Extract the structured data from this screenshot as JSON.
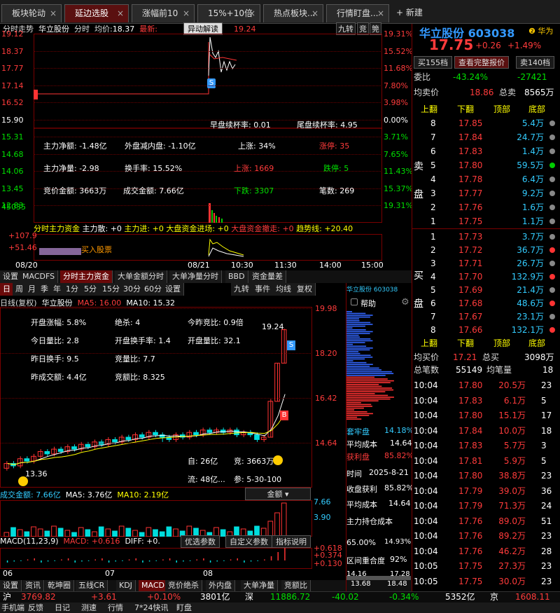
{
  "tabs": [
    {
      "label": "板块轮动"
    },
    {
      "label": "延边选股",
      "active": true
    },
    {
      "label": "涨幅前10"
    },
    {
      "label": "15%+10倍"
    },
    {
      "label": "热点板块..."
    },
    {
      "label": "行情盯盘..."
    }
  ],
  "new_tab_label": "新建",
  "intraday": {
    "header_prefix": "分时走势",
    "stock": "华立股份",
    "mode": "分时",
    "avg_label": "均价:",
    "avg_value": "18.37",
    "latest_label": "最新:",
    "latest_value": "19.24",
    "popup_btn": "异动解读",
    "right_btn1": "九转",
    "right_btn2": "竞",
    "right_btn3": "筦",
    "price_ticks": [
      "19.12",
      "18.37",
      "17.77",
      "17.14",
      "16.52",
      "15.90",
      "15.31",
      "14.68",
      "14.06",
      "13.45",
      "12.83"
    ],
    "pct_ticks": [
      "19.31%",
      "15.52%",
      "11.68%",
      "7.80%",
      "3.98%",
      "0.00%",
      "3.71%",
      "7.65%",
      "11.43%",
      "15.37%",
      "19.31%"
    ],
    "volume_top": "45035",
    "overlay": [
      [
        "早盘续杯率: 0.01",
        "尾盘续杯率: 4.95"
      ],
      [
        "主力净额: -1.48亿",
        "外盘减内盘: -1.10亿",
        "上涨: 34%",
        "涨停: 35"
      ],
      [
        "主力净量: -2.98",
        "换手率: 15.52%",
        "上涨: 1669",
        "跌停: 5"
      ],
      [
        "竞价金额: 3663万",
        "成交金额: 7.66亿",
        "下跌: 3307",
        "笔数: 269"
      ]
    ],
    "main_force_line": {
      "title": "分时主力资金",
      "a": "主力散: +0",
      "b": "主力进: +0",
      "c": "大盘资金进场: +0",
      "d": "大盘资金撤走: +0",
      "e": "趋势线: +20.40"
    },
    "mf_ticks": [
      "+107.9",
      "+51.46"
    ],
    "buy_label": "买入股票",
    "time_ticks": [
      "08/20",
      "08/21",
      "10:30",
      "11:30",
      "14:00",
      "15:00"
    ],
    "sub_tabs": [
      "设置",
      "MACDFS",
      "分时主力资金",
      "大单金额分时",
      "大单净量分时",
      "BBD",
      "资金量差"
    ]
  },
  "kline": {
    "periods": [
      "日",
      "周",
      "月",
      "季",
      "年",
      "1分",
      "5分",
      "15分",
      "30分",
      "60分",
      "设置"
    ],
    "right_btns": [
      "九转",
      "事件",
      "均线",
      "复权"
    ],
    "header_label": "日线(复权)",
    "stock": "华立股份",
    "ma5": "MA5: 16.00",
    "ma10": "MA10: 15.32",
    "price_ticks": [
      "19.98",
      "18.20",
      "16.42",
      "14.64"
    ],
    "info": [
      [
        "开盘涨幅: 5.8%",
        "绝杀: 4",
        "今昨竞比: 0.9倍"
      ],
      [
        "今日量比: 2.8",
        "开盘换手率: 1.4",
        "开盘量比: 32.1"
      ],
      [
        "昨日换手: 9.5",
        "竞量比: 7.7"
      ],
      [
        "昨成交额: 4.4亿",
        "竞额比: 8.325"
      ]
    ],
    "high_mark": "19.24",
    "low_mark": "13.36",
    "free_cap": "自: 26亿",
    "bid_amt": "竞: 3663万",
    "float_cap": "流: 48亿...",
    "params": "参: 5-30-100",
    "amount_label": "成交金额: 7.66亿",
    "amount_ma5": "MA5: 3.76亿",
    "amount_ma10": "MA10: 2.19亿",
    "amount_select": "金额",
    "amount_ticks": [
      "7.66",
      "3.90"
    ],
    "macd_label": "MACD(11,23,9)",
    "macd_val": "MACD: +0.616",
    "diff_val": "DIFF: +0.",
    "macd_btns": [
      "优选参数",
      "自定义参数",
      "指标说明"
    ],
    "macd_ticks": [
      "+0.618",
      "+0.374",
      "+0.130"
    ],
    "months": [
      "06",
      "07",
      "08"
    ],
    "sub_tabs": [
      "设置",
      "资讯",
      "乾坤圈",
      "五线CR",
      "KDJ",
      "MACD",
      "竞价绝杀",
      "外内盘",
      "大单净量",
      "竞额比"
    ],
    "candles": [
      {
        "o": 13.4,
        "c": 13.6,
        "h": 13.7,
        "l": 13.3
      },
      {
        "o": 13.6,
        "c": 13.5,
        "h": 13.7,
        "l": 13.4
      },
      {
        "o": 13.5,
        "c": 13.8,
        "h": 13.9,
        "l": 13.4
      },
      {
        "o": 13.8,
        "c": 13.7,
        "h": 13.9,
        "l": 13.6
      },
      {
        "o": 13.7,
        "c": 13.9,
        "h": 14.0,
        "l": 13.6
      },
      {
        "o": 13.9,
        "c": 14.1,
        "h": 14.2,
        "l": 13.8
      },
      {
        "o": 14.1,
        "c": 14.0,
        "h": 14.2,
        "l": 13.9
      },
      {
        "o": 14.0,
        "c": 14.2,
        "h": 14.3,
        "l": 13.9
      },
      {
        "o": 14.2,
        "c": 14.1,
        "h": 14.3,
        "l": 14.0
      },
      {
        "o": 14.1,
        "c": 14.3,
        "h": 14.4,
        "l": 14.0
      },
      {
        "o": 14.3,
        "c": 14.2,
        "h": 14.4,
        "l": 14.1
      },
      {
        "o": 14.2,
        "c": 14.4,
        "h": 14.5,
        "l": 14.1
      },
      {
        "o": 14.4,
        "c": 14.3,
        "h": 14.5,
        "l": 14.2
      },
      {
        "o": 14.3,
        "c": 14.5,
        "h": 14.6,
        "l": 14.2
      },
      {
        "o": 14.5,
        "c": 14.4,
        "h": 14.6,
        "l": 14.3
      },
      {
        "o": 14.4,
        "c": 14.6,
        "h": 14.7,
        "l": 14.3
      },
      {
        "o": 14.6,
        "c": 14.5,
        "h": 14.7,
        "l": 14.4
      },
      {
        "o": 14.5,
        "c": 14.7,
        "h": 14.8,
        "l": 14.4
      },
      {
        "o": 14.7,
        "c": 14.6,
        "h": 14.8,
        "l": 14.5
      },
      {
        "o": 14.6,
        "c": 14.8,
        "h": 14.9,
        "l": 14.5
      },
      {
        "o": 14.8,
        "c": 14.7,
        "h": 14.9,
        "l": 14.6
      },
      {
        "o": 14.7,
        "c": 14.9,
        "h": 15.0,
        "l": 14.6
      },
      {
        "o": 14.9,
        "c": 14.8,
        "h": 15.0,
        "l": 14.7
      },
      {
        "o": 14.8,
        "c": 14.7,
        "h": 14.9,
        "l": 14.5
      },
      {
        "o": 14.7,
        "c": 14.6,
        "h": 14.8,
        "l": 14.5
      },
      {
        "o": 14.6,
        "c": 14.8,
        "h": 14.9,
        "l": 14.5
      },
      {
        "o": 14.8,
        "c": 14.7,
        "h": 14.9,
        "l": 14.6
      },
      {
        "o": 14.7,
        "c": 14.9,
        "h": 15.0,
        "l": 14.6
      },
      {
        "o": 14.9,
        "c": 14.8,
        "h": 15.0,
        "l": 14.7
      },
      {
        "o": 14.8,
        "c": 15.0,
        "h": 15.1,
        "l": 14.7
      },
      {
        "o": 15.0,
        "c": 14.9,
        "h": 15.1,
        "l": 14.8
      },
      {
        "o": 14.9,
        "c": 15.0,
        "h": 15.1,
        "l": 14.8
      },
      {
        "o": 15.0,
        "c": 14.9,
        "h": 15.1,
        "l": 14.8
      },
      {
        "o": 14.9,
        "c": 15.0,
        "h": 15.1,
        "l": 14.8
      },
      {
        "o": 15.0,
        "c": 14.8,
        "h": 15.1,
        "l": 14.7
      },
      {
        "o": 14.8,
        "c": 14.9,
        "h": 15.0,
        "l": 14.7
      },
      {
        "o": 14.9,
        "c": 14.8,
        "h": 15.0,
        "l": 14.7
      },
      {
        "o": 14.8,
        "c": 14.6,
        "h": 14.9,
        "l": 14.5
      },
      {
        "o": 14.6,
        "c": 14.7,
        "h": 14.8,
        "l": 14.5
      },
      {
        "o": 14.7,
        "c": 16.2,
        "h": 16.3,
        "l": 14.7
      },
      {
        "o": 16.2,
        "c": 17.8,
        "h": 17.8,
        "l": 16.2
      },
      {
        "o": 17.8,
        "c": 19.2,
        "h": 19.24,
        "l": 17.8
      }
    ]
  },
  "quote": {
    "name": "华立股份",
    "code": "603038",
    "badge": "华为",
    "price": "17.75",
    "change": "+0.26",
    "pct": "+1.49%",
    "btn_buy": "买155档",
    "btn_report": "查看完整报价",
    "btn_sell": "卖140档",
    "weibi_label": "委比",
    "weibi": "-43.24%",
    "weicha": "-27421",
    "avg_label": "均卖价",
    "avg": "18.86",
    "total_label": "总卖",
    "total": "8565万",
    "col_up": "上翻",
    "col_down": "下翻",
    "col_top": "顶部",
    "col_bottom": "底部",
    "sell_side": "卖盘",
    "buy_side": "买盘",
    "asks": [
      {
        "n": "8",
        "p": "17.85",
        "v": "5.4万",
        "dot": "#888"
      },
      {
        "n": "7",
        "p": "17.84",
        "v": "24.7万",
        "dot": "#888"
      },
      {
        "n": "6",
        "p": "17.83",
        "v": "1.4万",
        "dot": "#888"
      },
      {
        "n": "5",
        "p": "17.80",
        "v": "59.5万",
        "dot": "#00cc00"
      },
      {
        "n": "4",
        "p": "17.78",
        "v": "6.4万",
        "dot": "#888"
      },
      {
        "n": "3",
        "p": "17.77",
        "v": "9.2万",
        "dot": "#888"
      },
      {
        "n": "2",
        "p": "17.76",
        "v": "1.6万",
        "dot": "#888"
      },
      {
        "n": "1",
        "p": "17.75",
        "v": "1.1万",
        "dot": "#888"
      }
    ],
    "bids": [
      {
        "n": "1",
        "p": "17.73",
        "v": "3.7万",
        "dot": "#888"
      },
      {
        "n": "2",
        "p": "17.72",
        "v": "36.7万",
        "dot": "#ff3333"
      },
      {
        "n": "3",
        "p": "17.71",
        "v": "26.7万",
        "dot": "#888"
      },
      {
        "n": "4",
        "p": "17.70",
        "v": "132.9万",
        "dot": "#ff3333"
      },
      {
        "n": "5",
        "p": "17.69",
        "v": "21.4万",
        "dot": "#888"
      },
      {
        "n": "6",
        "p": "17.68",
        "v": "48.6万",
        "dot": "#ff3333"
      },
      {
        "n": "7",
        "p": "17.67",
        "v": "23.1万",
        "dot": "#888"
      },
      {
        "n": "8",
        "p": "17.66",
        "v": "132.1万",
        "dot": "#ff3333"
      }
    ],
    "bid_avg_label": "均买价",
    "bid_avg": "17.21",
    "bid_total_label": "总买",
    "bid_total": "3098万",
    "deals_label": "总笔数",
    "deals": "55149",
    "per_label": "均笔量",
    "per": "18",
    "ticks": [
      {
        "t": "10:04",
        "p": "17.80",
        "v": "20.5万",
        "c": "23",
        "pc": "red"
      },
      {
        "t": "10:04",
        "p": "17.83",
        "v": "6.1万",
        "c": "5",
        "pc": "red"
      },
      {
        "t": "10:04",
        "p": "17.80",
        "v": "15.1万",
        "c": "17",
        "pc": "red"
      },
      {
        "t": "10:04",
        "p": "17.84",
        "v": "10.0万",
        "c": "18",
        "pc": "red"
      },
      {
        "t": "10:04",
        "p": "17.83",
        "v": "5.7万",
        "c": "3",
        "pc": "red"
      },
      {
        "t": "10:04",
        "p": "17.81",
        "v": "5.9万",
        "c": "5",
        "pc": "red"
      },
      {
        "t": "10:04",
        "p": "17.80",
        "v": "38.8万",
        "c": "23",
        "pc": "red"
      },
      {
        "t": "10:04",
        "p": "17.79",
        "v": "39.0万",
        "c": "36",
        "pc": "red"
      },
      {
        "t": "10:04",
        "p": "17.79",
        "v": "71.3万",
        "c": "24",
        "pc": "red"
      },
      {
        "t": "10:04",
        "p": "17.76",
        "v": "89.0万",
        "c": "51",
        "pc": "red"
      },
      {
        "t": "10:04",
        "p": "17.76",
        "v": "89.2万",
        "c": "23",
        "pc": "red"
      },
      {
        "t": "10:04",
        "p": "17.76",
        "v": "46.2万",
        "c": "28",
        "pc": "red"
      },
      {
        "t": "10:05",
        "p": "17.75",
        "v": "27.3万",
        "c": "23",
        "pc": "red"
      },
      {
        "t": "10:05",
        "p": "17.75",
        "v": "30.0万",
        "c": "23",
        "pc": "red"
      }
    ]
  },
  "chip": {
    "header_stock": "华立股份",
    "header_code": "603038",
    "help": "帮助",
    "profit_label": "套牢盘",
    "profit_val": "14.18%",
    "avgcost_label": "平均成本",
    "avgcost_val": "14.64",
    "winrate_label": "获利盘",
    "winrate_val": "85.82%",
    "time_label": "时间",
    "time_val": "2025-8-21",
    "rate_label": "收盘获利",
    "rate_val": "85.82%",
    "avg2_label": "平均成本",
    "avg2_val": "14.64",
    "mf_cost_label": "主力持仓成本",
    "c65": "65.00%",
    "c65v": "14.93%",
    "overlap_label": "区间重合度",
    "overlap_val": "92%",
    "range_lo": "14.16",
    "range_hi": "17.28",
    "range2_lo": "13.68",
    "range2_hi": "18.48"
  },
  "status": {
    "sh": "沪",
    "sh_val": "3769.82",
    "sh_chg": "+3.61",
    "sh_pct": "+0.10%",
    "sh_amt": "3801亿",
    "sz": "深",
    "sz_val": "11886.72",
    "sz_chg": "-40.02",
    "sz_pct": "-0.34%",
    "sz_amt": "5352亿",
    "bj": "京",
    "bj_val": "1608.11"
  },
  "bottom_items": [
    "手机端",
    "反馈",
    "日记",
    "测速",
    "行情",
    "7*24快讯",
    "盯盘"
  ]
}
